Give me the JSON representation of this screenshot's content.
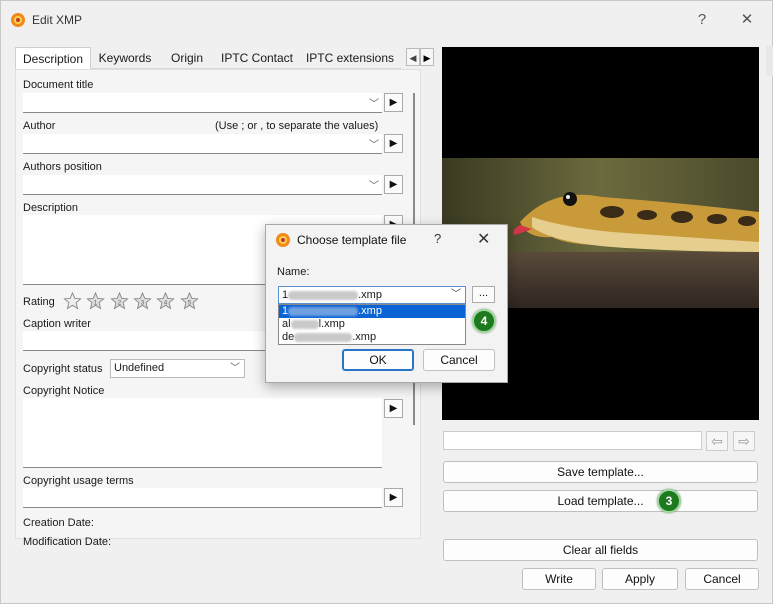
{
  "window": {
    "title": "Edit XMP",
    "help_glyph": "?",
    "close_glyph": "✕"
  },
  "tabs": [
    {
      "label": "Description"
    },
    {
      "label": "Keywords"
    },
    {
      "label": "Origin"
    },
    {
      "label": "IPTC Contact"
    },
    {
      "label": "IPTC extensions"
    }
  ],
  "form": {
    "document_title_label": "Document title",
    "author_label": "Author",
    "author_hint": "(Use ; or , to separate the values)",
    "authors_position_label": "Authors position",
    "description_label": "Description",
    "rating_label": "Rating",
    "caption_writer_label": "Caption writer",
    "copyright_status_label": "Copyright status",
    "copyright_status_value": "Undefined",
    "copyright_notice_label": "Copyright Notice",
    "copyright_usage_label": "Copyright usage terms",
    "creation_date_label": "Creation Date:",
    "modification_date_label": "Modification Date:",
    "rating_value": 0,
    "rating_max": 6
  },
  "buttons": {
    "save_template": "Save template...",
    "load_template": "Load template...",
    "clear_all": "Clear all fields",
    "write": "Write",
    "apply": "Apply",
    "cancel": "Cancel"
  },
  "badges": {
    "load_step": "3",
    "dialog_step": "4"
  },
  "dialog": {
    "title": "Choose template file",
    "help_glyph": "?",
    "close_glyph": "✕",
    "name_label": "Name:",
    "selected_suffix": ".xmp",
    "selected_prefix": "1",
    "browse_label": "...",
    "options": [
      {
        "prefix": "1",
        "suffix": ".xmp",
        "selected": true
      },
      {
        "prefix": "al",
        "suffix": "l.xmp",
        "selected": false
      },
      {
        "prefix": "de",
        "suffix": ".xmp",
        "selected": false
      }
    ],
    "ok": "OK",
    "cancel": "Cancel"
  },
  "colors": {
    "accent": "#0a64d6",
    "badge": "#1e7a1e"
  }
}
